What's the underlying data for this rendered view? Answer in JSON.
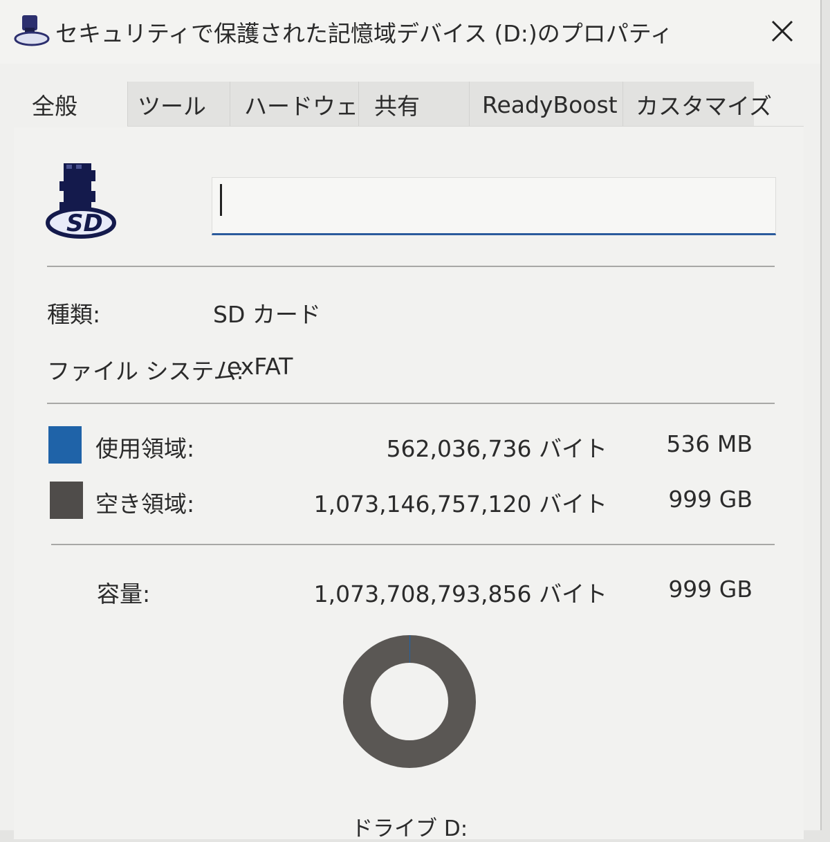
{
  "window": {
    "title": "セキュリティで保護された記憶域デバイス (D:)のプロパティ"
  },
  "tabs": [
    {
      "label": "全般"
    },
    {
      "label": "ツール"
    },
    {
      "label": "ハードウェア"
    },
    {
      "label": "共有"
    },
    {
      "label": "ReadyBoost"
    },
    {
      "label": "カスタマイズ"
    }
  ],
  "general": {
    "volume_label_value": "",
    "type_label": "種類:",
    "type_value": "SD カード",
    "fs_label": "ファイル システム:",
    "fs_value": "exFAT",
    "used": {
      "label": "使用領域:",
      "bytes": "562,036,736 バイト",
      "size": "536 MB",
      "color": "#1f63a8"
    },
    "free": {
      "label": "空き領域:",
      "bytes": "1,073,146,757,120 バイト",
      "size": "999 GB",
      "color": "#4f4c4a"
    },
    "capacity": {
      "label": "容量:",
      "bytes": "1,073,708,793,856 バイト",
      "size": "999 GB"
    },
    "drive_label": "ドライブ D:"
  },
  "icons": {
    "title_icon": "sd-device-icon",
    "close_icon": "close-icon",
    "drive_icon": "sd-card-icon"
  }
}
